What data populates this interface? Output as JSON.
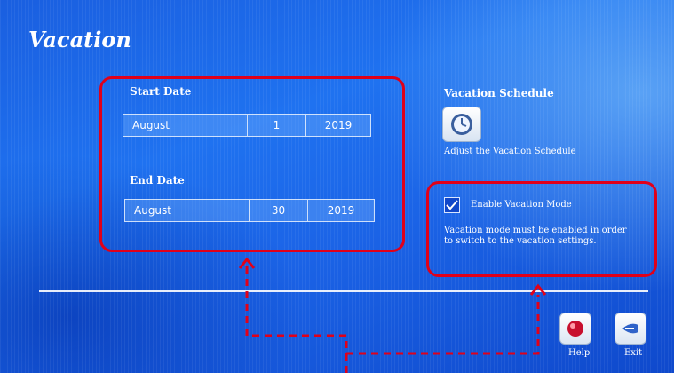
{
  "header": {
    "title": "Vacation"
  },
  "start_date": {
    "label": "Start Date",
    "month": "August",
    "day": "1",
    "year": "2019"
  },
  "end_date": {
    "label": "End Date",
    "month": "August",
    "day": "30",
    "year": "2019"
  },
  "schedule": {
    "heading": "Vacation Schedule",
    "icon": "clock-icon",
    "caption": "Adjust the Vacation Schedule"
  },
  "vacation_mode": {
    "checkbox_label": "Enable Vacation Mode",
    "checked": true,
    "note": "Vacation mode must be enabled in order to switch to the vacation settings."
  },
  "footer": {
    "help_label": "Help",
    "exit_label": "Exit"
  },
  "colors": {
    "annotation": "#e0001a",
    "background": "#1f72f0"
  }
}
